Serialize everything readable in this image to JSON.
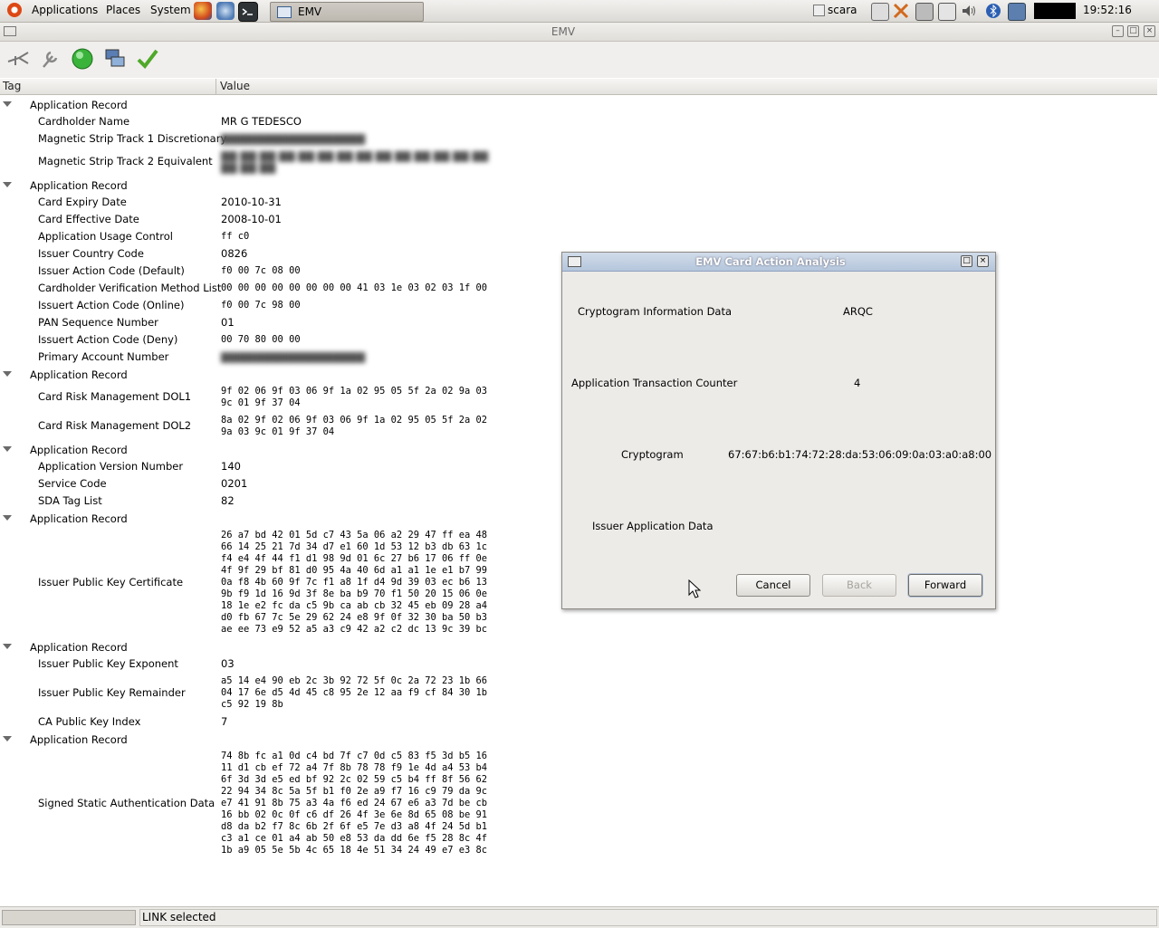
{
  "panel": {
    "menus": [
      "Applications",
      "Places",
      "System"
    ],
    "task_label": "EMV",
    "user": "scara",
    "clock": "19:52:16"
  },
  "window": {
    "title": "EMV",
    "columns": [
      "Tag",
      "Value"
    ]
  },
  "tree": [
    {
      "kind": "group",
      "label": "Application Record"
    },
    {
      "kind": "item",
      "tag": "Cardholder Name",
      "value": "MR G TEDESCO"
    },
    {
      "kind": "item",
      "tag": "Magnetic Strip Track 1 Discretionary",
      "value": "",
      "redacted": true
    },
    {
      "kind": "item",
      "tag": "Magnetic Strip Track 2 Equivalent",
      "value": "",
      "redacted": true
    },
    {
      "kind": "group",
      "label": "Application Record"
    },
    {
      "kind": "item",
      "tag": "Card Expiry Date",
      "value": "2010-10-31"
    },
    {
      "kind": "item",
      "tag": "Card Effective Date",
      "value": "2008-10-01"
    },
    {
      "kind": "item",
      "tag": "Application Usage Control",
      "value": "ff c0"
    },
    {
      "kind": "item",
      "tag": "Issuer Country Code",
      "value": "0826"
    },
    {
      "kind": "item",
      "tag": "Issuer Action Code (Default)",
      "value": "f0 00 7c 08 00"
    },
    {
      "kind": "item",
      "tag": "Cardholder Verification Method List",
      "value": "00 00 00 00 00 00 00 00 41 03 1e 03 02 03 1f 00"
    },
    {
      "kind": "item",
      "tag": "Issuert Action Code (Online)",
      "value": "f0 00 7c 98 00"
    },
    {
      "kind": "item",
      "tag": "PAN Sequence Number",
      "value": "01"
    },
    {
      "kind": "item",
      "tag": "Issuert Action Code (Deny)",
      "value": "00 70 80 00 00"
    },
    {
      "kind": "item",
      "tag": "Primary Account Number",
      "value": "",
      "redacted": true
    },
    {
      "kind": "group",
      "label": "Application Record"
    },
    {
      "kind": "item",
      "tag": "Card Risk Management DOL1",
      "value": "9f 02 06 9f 03 06 9f 1a 02 95 05 5f 2a 02 9a 03\n9c 01 9f 37 04"
    },
    {
      "kind": "item",
      "tag": "Card Risk Management DOL2",
      "value": "8a 02 9f 02 06 9f 03 06 9f 1a 02 95 05 5f 2a 02\n9a 03 9c 01 9f 37 04"
    },
    {
      "kind": "group",
      "label": "Application Record"
    },
    {
      "kind": "item",
      "tag": "Application Version Number",
      "value": "140"
    },
    {
      "kind": "item",
      "tag": "Service Code",
      "value": "0201"
    },
    {
      "kind": "item",
      "tag": "SDA Tag List",
      "value": "82"
    },
    {
      "kind": "group",
      "label": "Application Record"
    },
    {
      "kind": "item",
      "tag": "Issuer Public Key Certificate",
      "value": "26 a7 bd 42 01 5d c7 43 5a 06 a2 29 47 ff ea 48\n66 14 25 21 7d 34 d7 e1 60 1d 53 12 b3 db 63 1c\nf4 e4 4f 44 f1 d1 98 9d 01 6c 27 b6 17 06 ff 0e\n4f 9f 29 bf 81 d0 95 4a 40 6d a1 a1 1e e1 b7 99\n0a f8 4b 60 9f 7c f1 a8 1f d4 9d 39 03 ec b6 13\n9b f9 1d 16 9d 3f 8e ba b9 70 f1 50 20 15 06 0e\n18 1e e2 fc da c5 9b ca ab cb 32 45 eb 09 28 a4\nd0 fb 67 7c 5e 29 62 24 e8 9f 0f 32 30 ba 50 b3\nae ee 73 e9 52 a5 a3 c9 42 a2 c2 dc 13 9c 39 bc"
    },
    {
      "kind": "group",
      "label": "Application Record"
    },
    {
      "kind": "item",
      "tag": "Issuer Public Key Exponent",
      "value": "03"
    },
    {
      "kind": "item",
      "tag": "Issuer Public Key Remainder",
      "value": "a5 14 e4 90 eb 2c 3b 92 72 5f 0c 2a 72 23 1b 66\n04 17 6e d5 4d 45 c8 95 2e 12 aa f9 cf 84 30 1b\nc5 92 19 8b"
    },
    {
      "kind": "item",
      "tag": "CA Public Key Index",
      "value": "7"
    },
    {
      "kind": "group",
      "label": "Application Record"
    },
    {
      "kind": "item",
      "tag": "Signed Static Authentication Data",
      "value": "74 8b fc a1 0d c4 bd 7f c7 0d c5 83 f5 3d b5 16\n11 d1 cb ef 72 a4 7f 8b 78 78 f9 1e 4d a4 53 b4\n6f 3d 3d e5 ed bf 92 2c 02 59 c5 b4 ff 8f 56 62\n22 94 34 8c 5a 5f b1 f0 2e a9 f7 16 c9 79 da 9c\ne7 41 91 8b 75 a3 4a f6 ed 24 67 e6 a3 7d be cb\n16 bb 02 0c 0f c6 df 26 4f 3e 6e 8d 65 08 be 91\nd8 da b2 f7 8c 6b 2f 6f e5 7e d3 a8 4f 24 5d b1\nc3 a1 ce 01 a4 ab 50 e8 53 da dd 6e f5 28 8c 4f\n1b a9 05 5e 5b 4c 65 18 4e 51 34 24 49 e7 e3 8c"
    }
  ],
  "status": {
    "text": "LINK selected"
  },
  "dialog": {
    "title": "EMV Card Action Analysis",
    "cid_label": "Cryptogram Information Data",
    "cid_value": "ARQC",
    "atc_label": "Application Transaction Counter",
    "atc_value": "4",
    "cryptogram_label": "Cryptogram",
    "cryptogram_value": "67:67:b6:b1:74:72:28:da:53:06:09:0a:03:a0:a8:00",
    "iad_label": "Issuer Application Data",
    "cancel_label": "Cancel",
    "back_label": "Back",
    "forward_label": "Forward"
  }
}
